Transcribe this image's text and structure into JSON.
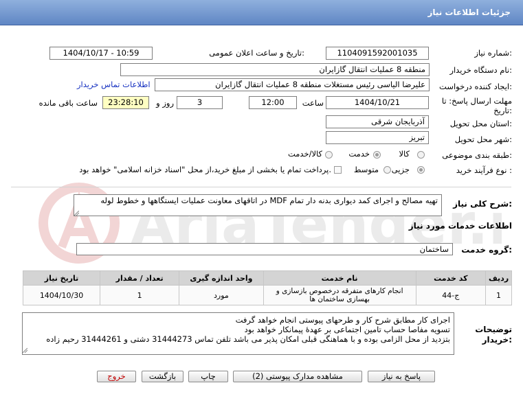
{
  "header": {
    "title": "جزئیات اطلاعات نیاز"
  },
  "watermark": {
    "text": "AriaTender.net"
  },
  "fields": {
    "need_number_label": "شماره نیاز:",
    "need_number": "1104091592001035",
    "announce_label": "تاریخ و ساعت اعلان عمومی:",
    "announce_value": "1404/10/17 - 10:59",
    "buyer_org_label": "نام دستگاه خریدار:",
    "buyer_org": "منطقه 8 عملیات انتقال گازایران",
    "creator_label": "ایجاد کننده درخواست:",
    "creator": "علیرضا الیاسی رئیس مستغلات منطقه 8 عملیات انتقال گازایران",
    "contact_link": "اطلاعات تماس خریدار",
    "deadline_label_1": "مهلت ارسال پاسخ: تا",
    "deadline_label_2": "تاریخ:",
    "deadline_date": "1404/10/21",
    "time_label": "ساعت",
    "deadline_time": "12:00",
    "days_value": "3",
    "days_label": "روز و",
    "remaining_time": "23:28:10",
    "remaining_label": "ساعت باقی مانده",
    "province_label": "استان محل تحویل:",
    "province": "آذربایجان شرقی",
    "city_label": "شهر محل تحویل:",
    "city": "تبریز",
    "category_label": "طبقه بندی موضوعی:",
    "category_options": [
      "کالا",
      "خدمت",
      "کالا/خدمت"
    ],
    "category_selected": "خدمت",
    "process_label": "نوع فرآیند خرید :",
    "process_options": [
      "جزیی",
      "متوسط"
    ],
    "process_selected": "جزیی",
    "payment_note": "پرداخت تمام یا بخشی از مبلغ خرید،از محل \"اسناد خزانه اسلامی\" خواهد بود."
  },
  "description": {
    "label": "شرح کلی نیاز:",
    "text": "تهیه مصالح و اجرای کمد دیواری بدنه دار تمام MDF در اتاقهای معاونت عملیات ایستگاهها و خطوط لوله"
  },
  "services": {
    "title": "اطلاعات خدمات مورد نیاز",
    "group_label": "گروه خدمت:",
    "group_value": "ساختمان",
    "table": {
      "headers": [
        "ردیف",
        "کد خدمت",
        "نام خدمت",
        "واحد اندازه گیری",
        "تعداد / مقدار",
        "تاریخ نیاز"
      ],
      "rows": [
        [
          "1",
          "ج-44",
          "انجام کارهای متفرقه درخصوص بازسازی و بهسازی ساختمان ها",
          "مورد",
          "1",
          "1404/10/30"
        ]
      ]
    }
  },
  "buyer_notes": {
    "label_1": "توضیحات",
    "label_2": "خریدار:",
    "lines": [
      "اجرای کار مطابق شرح کار و طرحهای پیوستی انجام خواهد گرفت",
      "تسویه مفاصا حساب تامین اجتماعی بر عهدهٔ پیمانکار خواهد بود",
      "بتزدید از محل الزامی بوده و با هماهنگی قبلی امکان پذیر می باشد تلفن تماس 31444273 دشتی و 31444261 رحیم زاده"
    ]
  },
  "buttons": {
    "reply": "پاسخ به نیاز",
    "view_docs": "مشاهده مدارک پیوستی (2)",
    "print": "چاپ",
    "back": "بازگشت",
    "exit": "خروج"
  },
  "colors": {
    "header": "#6f93cc",
    "remaining_bg": "#ffffc2",
    "link": "#1530c0",
    "exit_text": "#c00000"
  }
}
